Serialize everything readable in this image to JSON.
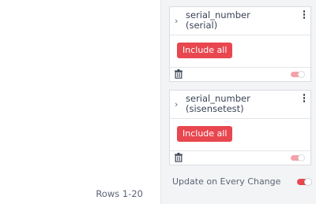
{
  "table": {
    "rows_label": "Rows 1-20"
  },
  "filters": [
    {
      "title_line1": "serial_number",
      "title_line2": "(serial)",
      "include_label": "Include all"
    },
    {
      "title_line1": "serial_number",
      "title_line2": "(sisensetest)",
      "include_label": "Include all"
    }
  ],
  "settings": {
    "update_label": "Update on Every Change",
    "update_enabled": true
  },
  "icons": {
    "chevron": "chevron-right-icon",
    "menu": "kebab-menu-icon",
    "delete": "trash-icon"
  },
  "colors": {
    "accent": "#e8474f",
    "toggle_faded": "#f2a3a8"
  }
}
